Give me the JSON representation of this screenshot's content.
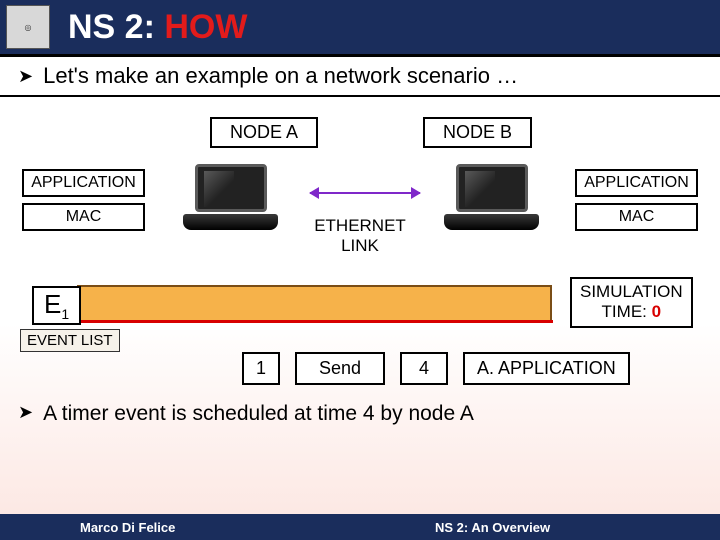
{
  "title": {
    "prefix": "NS 2: ",
    "emph": "HOW"
  },
  "intro": "Let's make an example on a network scenario …",
  "nodeA": {
    "label": "NODE A"
  },
  "nodeB": {
    "label": "NODE B"
  },
  "left_layers": {
    "app": "APPLICATION",
    "mac": "MAC"
  },
  "right_layers": {
    "app": "APPLICATION",
    "mac": "MAC"
  },
  "link_label": {
    "l1": "ETHERNET",
    "l2": "LINK"
  },
  "event_marker": {
    "sym": "E",
    "sub": "1"
  },
  "sim_time": {
    "l1": "SIMULATION",
    "l2_prefix": "TIME: ",
    "value": "0"
  },
  "event_list_label": "EVENT LIST",
  "event_row": {
    "id": "1",
    "action": "Send",
    "time": "4",
    "who": "A. APPLICATION"
  },
  "second_bullet": "A timer event is scheduled at time 4 by node A",
  "footer": {
    "left": "Marco Di Felice",
    "right": "NS 2: An Overview"
  }
}
